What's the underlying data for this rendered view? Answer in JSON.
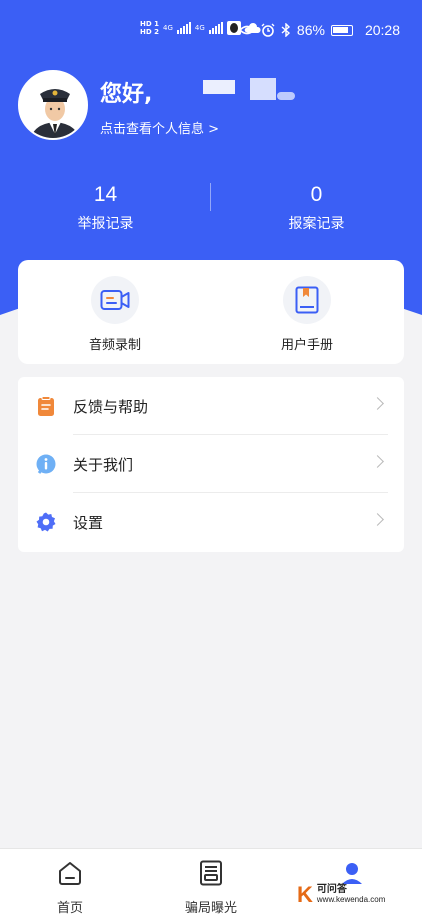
{
  "status_bar": {
    "hd1": "HD 1",
    "hd2": "HD 2",
    "net1": "4G",
    "net2": "4G",
    "battery": "86%",
    "time": "20:28"
  },
  "profile": {
    "greeting": "您好,",
    "link": "点击查看个人信息 >"
  },
  "stats": [
    {
      "value": "14",
      "label": "举报记录"
    },
    {
      "value": "0",
      "label": "报案记录"
    }
  ],
  "tools": [
    {
      "label": "音频录制",
      "icon": "video-record-icon"
    },
    {
      "label": "用户手册",
      "icon": "book-icon"
    }
  ],
  "menu": [
    {
      "label": "反馈与帮助",
      "icon": "clipboard-icon"
    },
    {
      "label": "关于我们",
      "icon": "info-icon"
    },
    {
      "label": "设置",
      "icon": "gear-icon"
    }
  ],
  "tabbar": [
    {
      "label": "首页",
      "icon": "home-icon"
    },
    {
      "label": "骗局曝光",
      "icon": "news-icon"
    },
    {
      "label": "",
      "icon": "person-icon"
    }
  ],
  "watermark": {
    "letter": "K",
    "name": "可问答",
    "url": "www.kewenda.com"
  },
  "colors": {
    "brand": "#3b5ff5",
    "background": "#f3f3f5",
    "watermark": "#e56a16"
  }
}
